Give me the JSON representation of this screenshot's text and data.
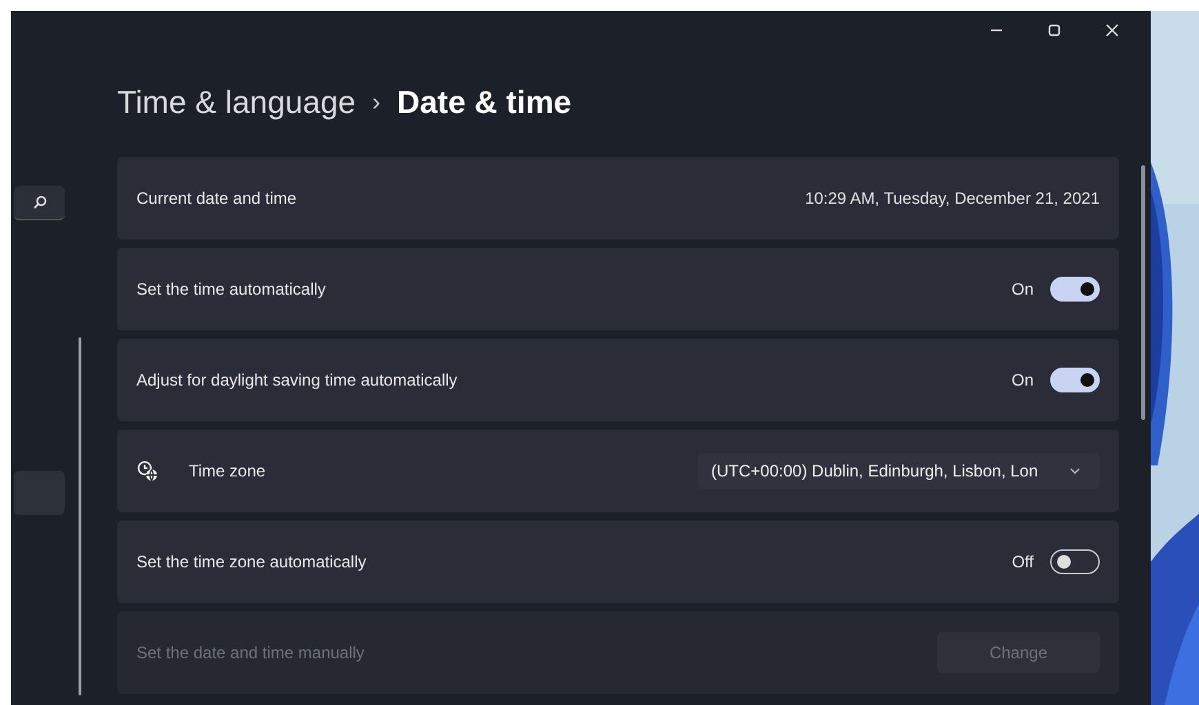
{
  "window": {
    "controls": [
      {
        "kind": "minimize"
      },
      {
        "kind": "maximize"
      },
      {
        "kind": "close"
      }
    ]
  },
  "breadcrumb": {
    "parent": "Time & language",
    "separator": "›",
    "current": "Date & time"
  },
  "sidebar": {
    "items": [
      {
        "kind": "search",
        "selected": false
      },
      {
        "kind": "item",
        "selected": true
      }
    ]
  },
  "settings": [
    {
      "kind": "info",
      "label": "Current date and time",
      "value": "10:29 AM, Tuesday, December 21, 2021",
      "disabled": false
    },
    {
      "kind": "toggle",
      "label": "Set the time automatically",
      "state": "On",
      "on": true,
      "disabled": false
    },
    {
      "kind": "toggle",
      "label": "Adjust for daylight saving time automatically",
      "state": "On",
      "on": true,
      "disabled": false
    },
    {
      "kind": "dropdown",
      "label": "Time zone",
      "value": "(UTC+00:00) Dublin, Edinburgh, Lisbon, Lon",
      "disabled": false
    },
    {
      "kind": "toggle",
      "label": "Set the time zone automatically",
      "state": "Off",
      "on": false,
      "disabled": false
    },
    {
      "kind": "button",
      "label": "Set the date and time manually",
      "button": "Change",
      "disabled": true
    }
  ]
}
